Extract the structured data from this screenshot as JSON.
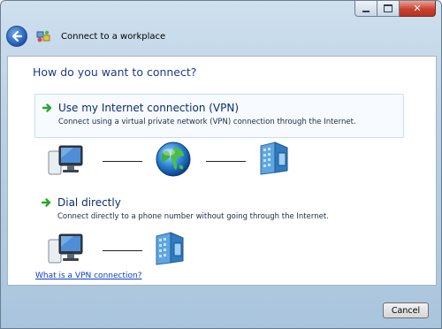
{
  "window": {
    "title": "Connect to a workplace",
    "controls": {
      "minimize_icon": "minimize-icon",
      "maximize_icon": "maximize-icon",
      "close_glyph": "✕"
    }
  },
  "nav": {
    "back_icon": "back-arrow-icon",
    "app_icon": "network-wizard-icon"
  },
  "main": {
    "heading": "How do you want to connect?",
    "options": [
      {
        "title": "Use my Internet connection (VPN)",
        "description": "Connect using a virtual private network (VPN) connection through the Internet.",
        "icon": "green-arrow-icon",
        "diagram": [
          "computer-icon",
          "globe-icon",
          "server-icon"
        ]
      },
      {
        "title": "Dial directly",
        "description": "Connect directly to a phone number without going through the Internet.",
        "icon": "green-arrow-icon",
        "diagram": [
          "computer-icon",
          "server-icon"
        ]
      }
    ],
    "help_link": "What is a VPN connection?"
  },
  "footer": {
    "cancel_label": "Cancel"
  },
  "colors": {
    "heading": "#1c3a8a",
    "link": "#0a3ec8",
    "arrow": "#2fa52f",
    "frame": "#b9d0e4"
  }
}
